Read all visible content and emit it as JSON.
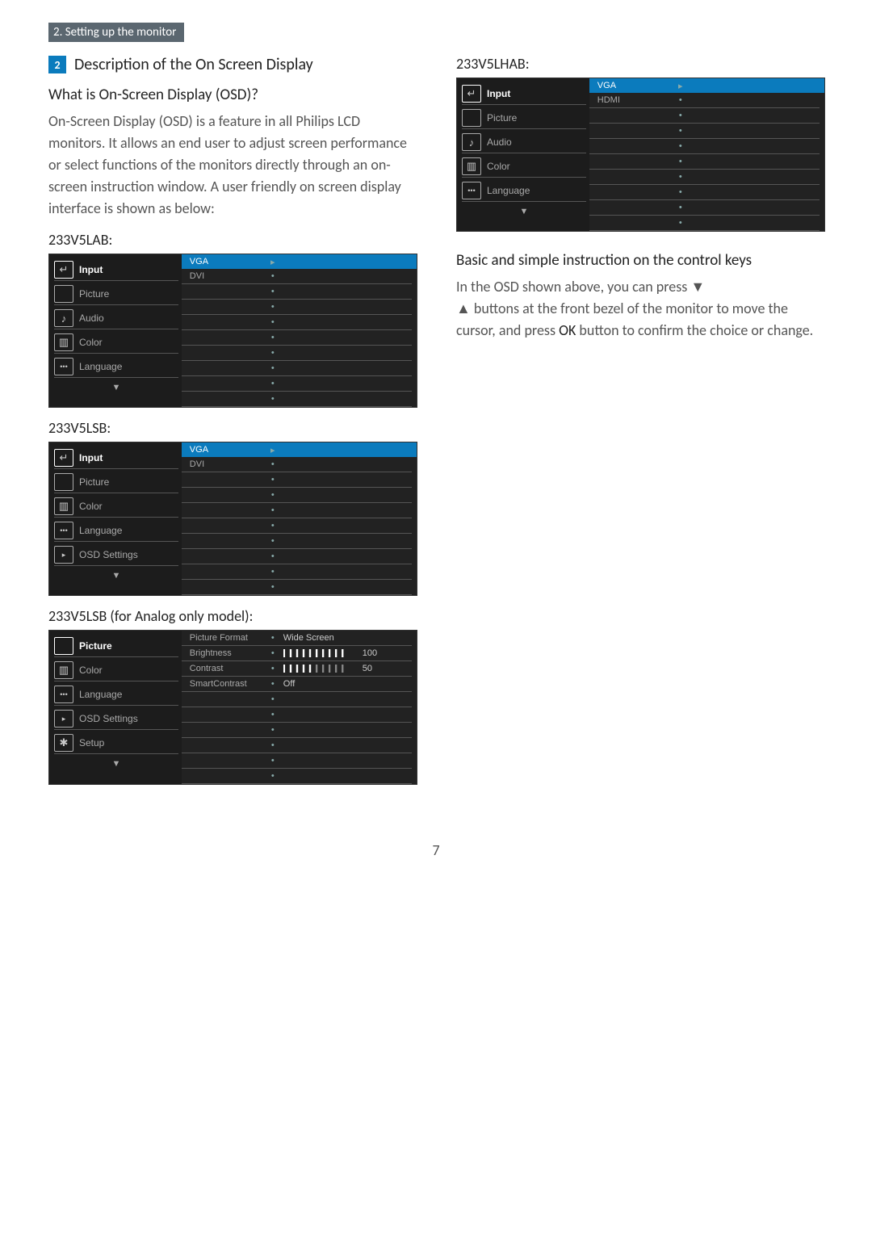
{
  "section_tab": "2. Setting up the monitor",
  "step_number": "2",
  "step_title": "Description of the On Screen Display",
  "sub_heading": "What is On-Screen Display (OSD)?",
  "intro_paragraph": "On-Screen Display (OSD) is a feature in all Philips LCD monitors. It allows an end user to adjust screen performance or select functions of the monitors directly through an on-screen instruction window. A user friendly on screen display interface is shown as below:",
  "models": {
    "lab": {
      "label": "233V5LAB:",
      "menu": [
        "Input",
        "Picture",
        "Audio",
        "Color",
        "Language"
      ],
      "sub_selected": [
        "VGA",
        "DVI"
      ]
    },
    "lsb": {
      "label": "233V5LSB:",
      "menu": [
        "Input",
        "Picture",
        "Color",
        "Language",
        "OSD Settings"
      ],
      "sub_selected": [
        "VGA",
        "DVI"
      ]
    },
    "lsb_analog": {
      "label": "233V5LSB (for Analog only model):",
      "menu": [
        "Picture",
        "Color",
        "Language",
        "OSD Settings",
        "Setup"
      ],
      "sub": [
        {
          "label": "Picture Format",
          "value": "Wide Screen"
        },
        {
          "label": "Brightness",
          "bar": 100,
          "valtext": "100"
        },
        {
          "label": "Contrast",
          "bar": 50,
          "valtext": "50"
        },
        {
          "label": "SmartContrast",
          "value": "Off"
        }
      ]
    },
    "lhab": {
      "label": "233V5LHAB:",
      "menu": [
        "Input",
        "Picture",
        "Audio",
        "Color",
        "Language"
      ],
      "sub_selected": [
        "VGA",
        "HDMI"
      ]
    }
  },
  "right_heading": "Basic and simple instruction on the control keys",
  "right_para_1": "In the OSD shown above, you can press ▼",
  "right_para_2": "▲ buttons at the front bezel of the monitor to move the cursor, and press ",
  "right_ok": "OK",
  "right_para_3": " button to confirm the choice or change.",
  "down_triangle": "▼",
  "page_number": "7",
  "icons": {
    "input": "input-icon",
    "picture": "picture-icon",
    "audio": "audio-icon",
    "color": "color-icon",
    "language": "language-icon",
    "osd": "osd-settings-icon",
    "setup": "setup-icon"
  }
}
